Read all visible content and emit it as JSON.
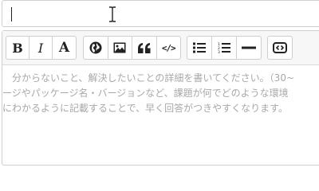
{
  "title_field": {
    "value": ""
  },
  "toolbar": {
    "bold_label": "B",
    "italic_label": "I",
    "heading_label": "A",
    "code_label": "</>"
  },
  "body_field": {
    "placeholder_lines": [
      "分からないこと、解決したいことの詳細を書いてください。（30~",
      "ージやパッケージ名・バージョンなど、課題が何でどのような環境",
      "にわかるように記載することで、早く回答がつきやすくなります。"
    ]
  }
}
